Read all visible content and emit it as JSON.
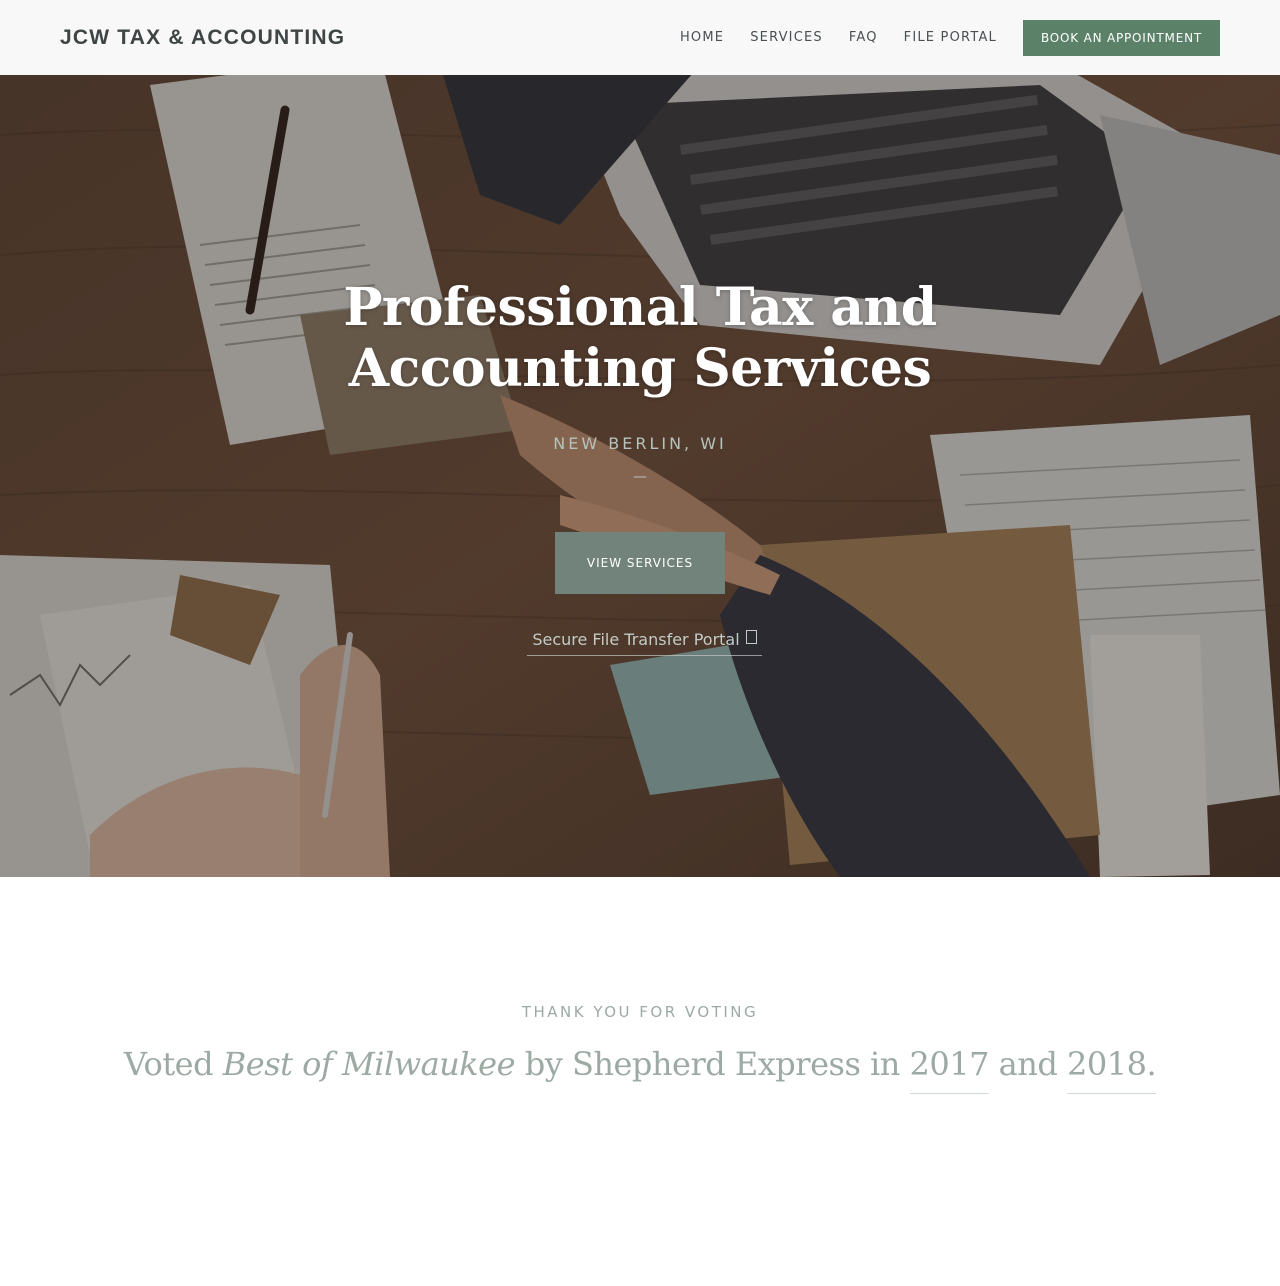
{
  "header": {
    "logo": "JCW TAX & ACCOUNTING",
    "nav": [
      {
        "label": "HOME"
      },
      {
        "label": "SERVICES"
      },
      {
        "label": "FAQ"
      },
      {
        "label": "FILE PORTAL"
      }
    ],
    "cta_label": "BOOK AN APPOINTMENT"
  },
  "hero": {
    "title": "Professional Tax and Accounting Services",
    "location": "NEW BERLIN, WI",
    "dash": "—",
    "button_label": "VIEW SERVICES",
    "portal_link": "Secure File Transfer Portal",
    "portal_icon": "external-link-icon"
  },
  "votes": {
    "kicker": "THANK YOU FOR VOTING",
    "line_prefix": "Voted ",
    "line_award": "Best of Milwaukee",
    "line_mid": " by Shepherd Express in ",
    "year1": "2017",
    "line_and": " and ",
    "year2": "2018."
  },
  "colors": {
    "header_bg": "#f8f8f8",
    "cta_bg": "#5b8168",
    "hero_button_bg": "#72837b",
    "muted_text": "#9caaa3"
  }
}
